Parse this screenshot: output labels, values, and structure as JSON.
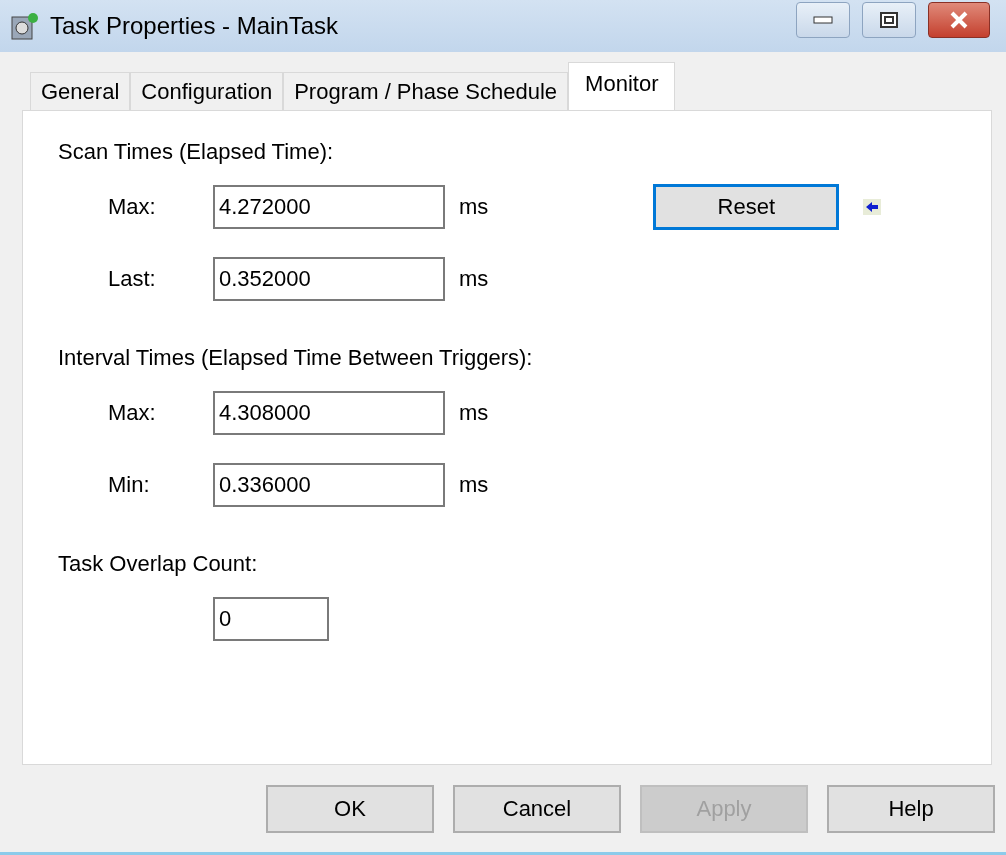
{
  "window": {
    "title": "Task Properties - MainTask"
  },
  "tabs": [
    {
      "label": "General",
      "selected": false
    },
    {
      "label": "Configuration",
      "selected": false
    },
    {
      "label": "Program / Phase Schedule",
      "selected": false
    },
    {
      "label": "Monitor",
      "selected": true
    }
  ],
  "sections": [
    {
      "title": "Scan Times (Elapsed Time):",
      "rows": [
        {
          "label": "Max:",
          "value": "4.272000",
          "unit": "ms"
        },
        {
          "label": "Last:",
          "value": "0.352000",
          "unit": "ms"
        }
      ],
      "reset_button": {
        "label": "Reset",
        "focused": true
      }
    },
    {
      "title": "Interval Times (Elapsed Time Between Triggers):",
      "rows": [
        {
          "label": "Max:",
          "value": "4.308000",
          "unit": "ms"
        },
        {
          "label": "Min:",
          "value": "0.336000",
          "unit": "ms"
        }
      ]
    },
    {
      "title": "Task Overlap Count:",
      "rows": [
        {
          "value": "0"
        }
      ]
    }
  ],
  "buttons": [
    {
      "label": "OK",
      "disabled": false
    },
    {
      "label": "Cancel",
      "disabled": false
    },
    {
      "label": "Apply",
      "disabled": true
    },
    {
      "label": "Help",
      "disabled": false
    }
  ]
}
